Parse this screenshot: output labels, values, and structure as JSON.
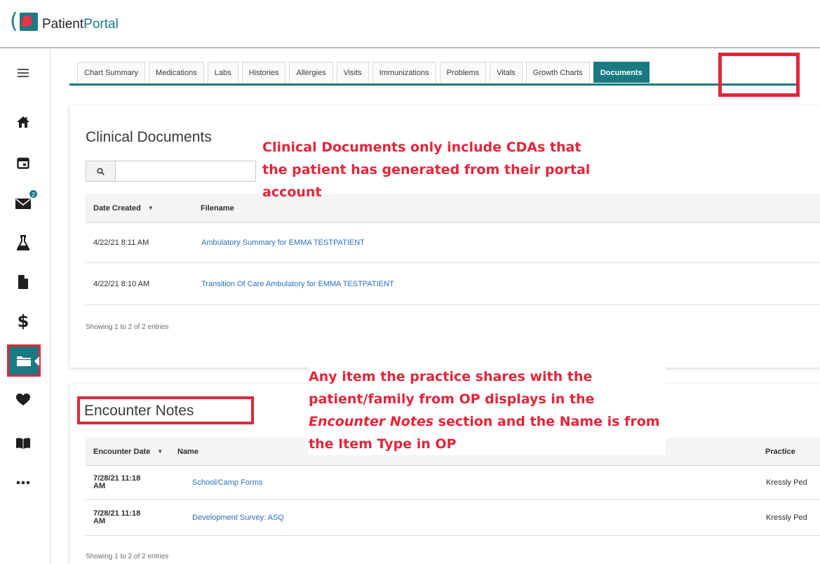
{
  "app": {
    "brand_part1": "Patient",
    "brand_part2": "Portal",
    "accent_color": "#1a7a82",
    "highlight_color": "#e3263a"
  },
  "sidebar": {
    "items": [
      {
        "icon": "menu-icon"
      },
      {
        "icon": "home-icon"
      },
      {
        "icon": "calendar-icon"
      },
      {
        "icon": "mail-icon",
        "badge": "2"
      },
      {
        "icon": "flask-icon"
      },
      {
        "icon": "document-icon"
      },
      {
        "icon": "dollar-icon"
      },
      {
        "icon": "folder-icon",
        "active": true
      },
      {
        "icon": "heart-icon"
      },
      {
        "icon": "book-icon"
      },
      {
        "icon": "more-icon"
      }
    ]
  },
  "tabs": [
    "Chart Summary",
    "Medications",
    "Labs",
    "Histories",
    "Allergies",
    "Visits",
    "Immunizations",
    "Problems",
    "Vitals",
    "Growth Charts",
    "Documents"
  ],
  "active_tab": "Documents",
  "clinical": {
    "title": "Clinical Documents",
    "search_placeholder": "",
    "columns": [
      "Date Created",
      "Filename"
    ],
    "rows": [
      {
        "date": "4/22/21 8:11 AM",
        "filename": "Ambulatory Summary for EMMA TESTPATIENT"
      },
      {
        "date": "4/22/21 8:10 AM",
        "filename": "Transition Of Care Ambulatory for EMMA TESTPATIENT"
      }
    ],
    "footer": "Showing 1 to 2 of 2 entries"
  },
  "encounter": {
    "title": "Encounter Notes",
    "columns": [
      "Encounter Date",
      "Name",
      "Practice"
    ],
    "rows": [
      {
        "date_line1": "7/28/21 11:18",
        "date_line2": "AM",
        "name": "School/Camp Forms",
        "practice": "Kressly Ped"
      },
      {
        "date_line1": "7/28/21 11:18",
        "date_line2": "AM",
        "name": "Development Survey: ASQ",
        "practice": "Kressly Ped"
      }
    ],
    "footer": "Showing 1 to 2 of 2 entries"
  },
  "annotations": {
    "clinical_lines": [
      "Clinical Documents only include CDAs that",
      "the patient has generated from their portal",
      "account"
    ],
    "encounter_line1": "Any item the practice shares with the",
    "encounter_line2": "patient/family from OP displays in the",
    "encounter_line3_em": "Encounter Notes",
    "encounter_line3_rest": " section and the Name is from",
    "encounter_line4": "the Item Type in OP"
  }
}
